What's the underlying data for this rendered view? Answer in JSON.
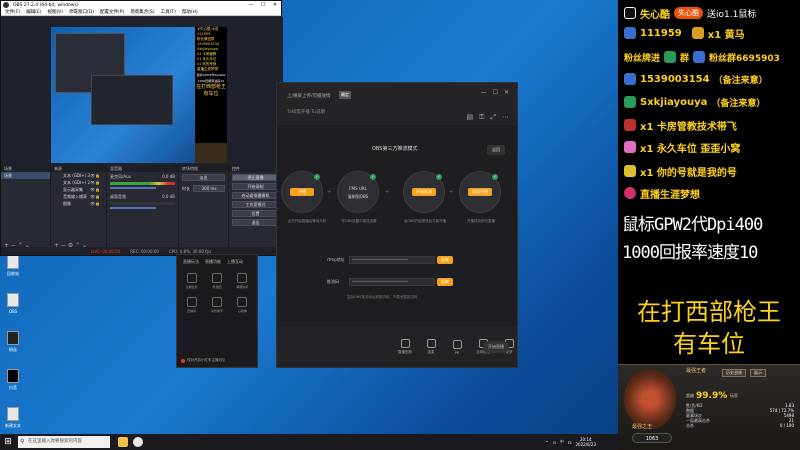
{
  "obs": {
    "title": "OBS 27.2.4 (64-bit, windows)",
    "window_controls": [
      "—",
      "☐",
      "✕"
    ],
    "menus": [
      "文件(F)",
      "编辑(E)",
      "视图(V)",
      "停靠窗口(D)",
      "配置文件(P)",
      "场景集合(S)",
      "工具(T)",
      "帮助(H)"
    ],
    "panels": {
      "scenes_title": "场景",
      "sources_title": "来源",
      "mixer_title": "混音器",
      "transitions_title": "转场特效",
      "controls_title": "控件"
    },
    "scenes": [
      "场景"
    ],
    "sources": [
      {
        "name": "文本 (GDI+) 3"
      },
      {
        "name": "文本 (GDI+) 2"
      },
      {
        "name": "显示器采集"
      },
      {
        "name": "音频输入捕获"
      },
      {
        "name": "图像"
      }
    ],
    "mixer": [
      {
        "name": "麦克风/Aux",
        "db": "0.0 dB"
      },
      {
        "name": "桌面音频",
        "db": "0.0 dB"
      }
    ],
    "transition": {
      "type": "淡出",
      "duration_label": "时长",
      "duration": "300 ms"
    },
    "controls": [
      "停止直播",
      "开始录制",
      "启动虚拟摄像机",
      "工作室模式",
      "设置",
      "退出"
    ],
    "statusbar": {
      "live": "LIVE: 00:00:00",
      "rec": "REC: 00:00:00",
      "cpu": "CPU: 0.8%, 30.00 fps"
    },
    "preview_overlay": {
      "lines": [
        "★失心酷 ★送",
        "111959",
        "粉丝牌进群",
        "1539003154",
        "Sxkjiayouya",
        "x1 卡房管教",
        "x1 永久车位",
        "x1 你的号就",
        "直播生涯梦想"
      ],
      "big1": "鼠标GPW2代Dpi400",
      "big2": "1000回报率速度10",
      "y1": "在打西部枪王",
      "y2": "有车位"
    }
  },
  "plugin": {
    "title": "上/横屏上传/可播放情",
    "btn": "确定",
    "user": "Ta如需开播",
    "user_sub": "Tu说明",
    "tools": [
      "▤",
      "⚿",
      "⤢",
      "⋯"
    ],
    "wc": [
      "—",
      "☐",
      "✕"
    ],
    "mode_title": "OBS第三方推流模式",
    "return_label": "返回",
    "steps": [
      {
        "label": "开播",
        "desc": "点击开始直播后等待几秒"
      },
      {
        "label": "FMS URL",
        "sub": "复制到OBS",
        "desc": "在OBS设置中推流设置"
      },
      {
        "label": "开始推流",
        "desc": "点OBS开始推流后才能开播"
      },
      {
        "label": "成功开播",
        "desc": "开播成功即可直播"
      }
    ],
    "rtmp_label": "rtmp地址",
    "rtmp_value": "****************************",
    "key_label": "推流码",
    "key_value": "****************************",
    "copy": "复制",
    "note": "复制OBS推流地址和推流码，不要泄露推流码",
    "bottom": [
      "直播回放",
      "连麦",
      "PK",
      "互动玩法",
      "更多"
    ],
    "start": "开始直播"
  },
  "side_panel": {
    "tabs": [
      "直播玩法",
      "直播功能",
      "上播互动"
    ],
    "items": [
      "主播任务",
      "粉丝团",
      "弹幕助手",
      "直播间",
      "房管助手",
      "心愿单"
    ],
    "footer": "仅对开启小红车主播可见"
  },
  "desktop_icons": [
    "回收站",
    "OBS",
    "粉丝",
    "抖音",
    "新建文本"
  ],
  "overlay": {
    "rows": [
      {
        "name": "失心酷",
        "pill": "失心酷",
        "gift": "送io1.1鼠标"
      },
      {
        "name": "111959",
        "gift": "x1 黄马"
      },
      {
        "name": "粉丝牌进",
        "mid": "群",
        "gift": "粉丝群6695903"
      },
      {
        "name": "1539003154",
        "note": "（备注来意）"
      },
      {
        "name": "Sxkjiayouya",
        "note": "（备注来意）"
      },
      {
        "gift": "x1 卡房管教技术带飞"
      },
      {
        "gift": "x1 永久车位 歪歪小窝"
      },
      {
        "gift": "x1 你的号就是我的号"
      },
      {
        "gift": "直播生涯梦想"
      }
    ],
    "big1": "鼠标GPW2代Dpi400",
    "big2": "1000回报率速度10",
    "yellow1": "在打西部枪王",
    "yellow2": "有车位",
    "rank": {
      "name": "最强王者",
      "pct_label": "超越",
      "pct": "99.9%",
      "pct_suffix": "玩家",
      "tabs": [
        "历史战绩",
        "展示"
      ],
      "champ": "最强之王",
      "score": "1063",
      "stats": [
        {
          "k": "胜/负/KD",
          "v": "1.83"
        },
        {
          "k": "数据",
          "v": "574 | 72.7%"
        },
        {
          "k": "赛事场次",
          "v": "5498"
        },
        {
          "k": "一局最高击杀",
          "v": "21"
        },
        {
          "k": "击杀",
          "v": "0 / 100"
        }
      ]
    }
  },
  "taskbar": {
    "search": "在这里输入你要搜索的内容",
    "tray": [
      "^",
      "⊡",
      "中",
      "☊"
    ],
    "time": "20:14",
    "date": "2022/6/23"
  },
  "colors": {
    "accent": "#f5a11a",
    "gold": "#ffd21a",
    "live": "#e33333"
  }
}
